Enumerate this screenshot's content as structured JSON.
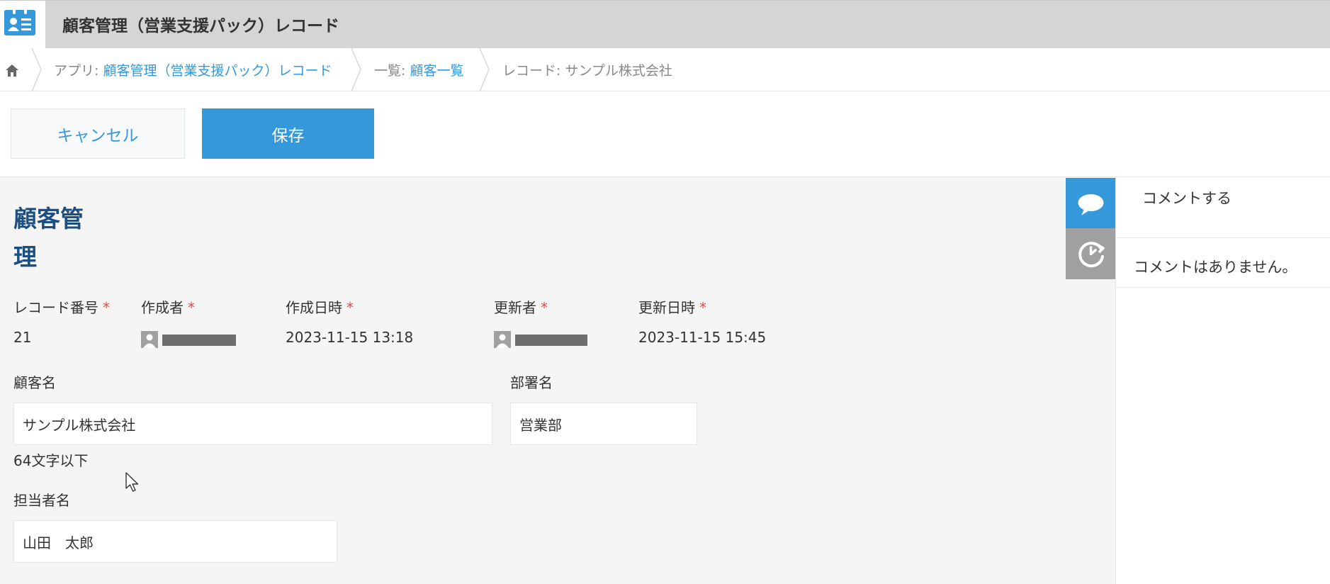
{
  "app": {
    "title": "顧客管理（営業支援パック）レコード"
  },
  "breadcrumb": {
    "app_prefix": "アプリ: ",
    "app_link": "顧客管理（営業支援パック）レコード",
    "list_prefix": "一覧: ",
    "list_link": "顧客一覧",
    "record": "レコード: サンプル株式会社"
  },
  "toolbar": {
    "cancel_label": "キャンセル",
    "save_label": "保存"
  },
  "form": {
    "title": "顧客管理",
    "fields": {
      "record_number": {
        "label": "レコード番号",
        "value": "21"
      },
      "creator": {
        "label": "作成者"
      },
      "created_at": {
        "label": "作成日時",
        "value": "2023-11-15 13:18"
      },
      "updater": {
        "label": "更新者"
      },
      "updated_at": {
        "label": "更新日時",
        "value": "2023-11-15 15:45"
      },
      "customer_name": {
        "label": "顧客名",
        "value": "サンプル株式会社",
        "hint": "64文字以下"
      },
      "department": {
        "label": "部署名",
        "value": "営業部"
      },
      "contact_name": {
        "label": "担当者名",
        "value": "山田　太郎"
      }
    },
    "required_mark": "*"
  },
  "sidebar": {
    "comment_cta": "コメントする",
    "empty_text": "コメントはありません。"
  },
  "colors": {
    "accent": "#3498db",
    "title": "#1c4f80",
    "required": "#e74c3c"
  }
}
